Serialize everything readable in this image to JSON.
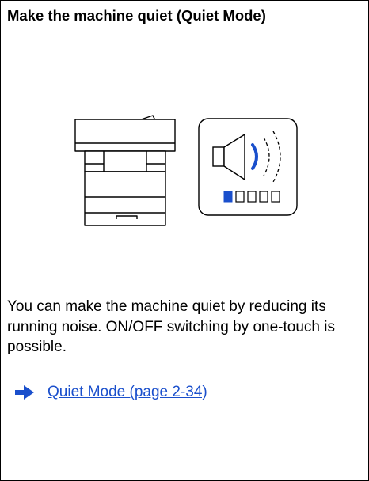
{
  "title": "Make the machine quiet (Quiet Mode)",
  "description": "You can make the machine quiet by reducing its running noise. ON/OFF switching by one-touch is possible.",
  "link": {
    "icon": "arrow-right-icon",
    "label": "Quiet Mode (page 2-34)"
  },
  "illustration": {
    "icons": [
      "printer-icon",
      "speaker-icon",
      "volume-level-indicator"
    ],
    "volume_level": {
      "filled": 1,
      "total": 5
    }
  },
  "colors": {
    "link": "#1a4fcc",
    "accent_blue": "#1a4fcc",
    "line": "#000000"
  }
}
